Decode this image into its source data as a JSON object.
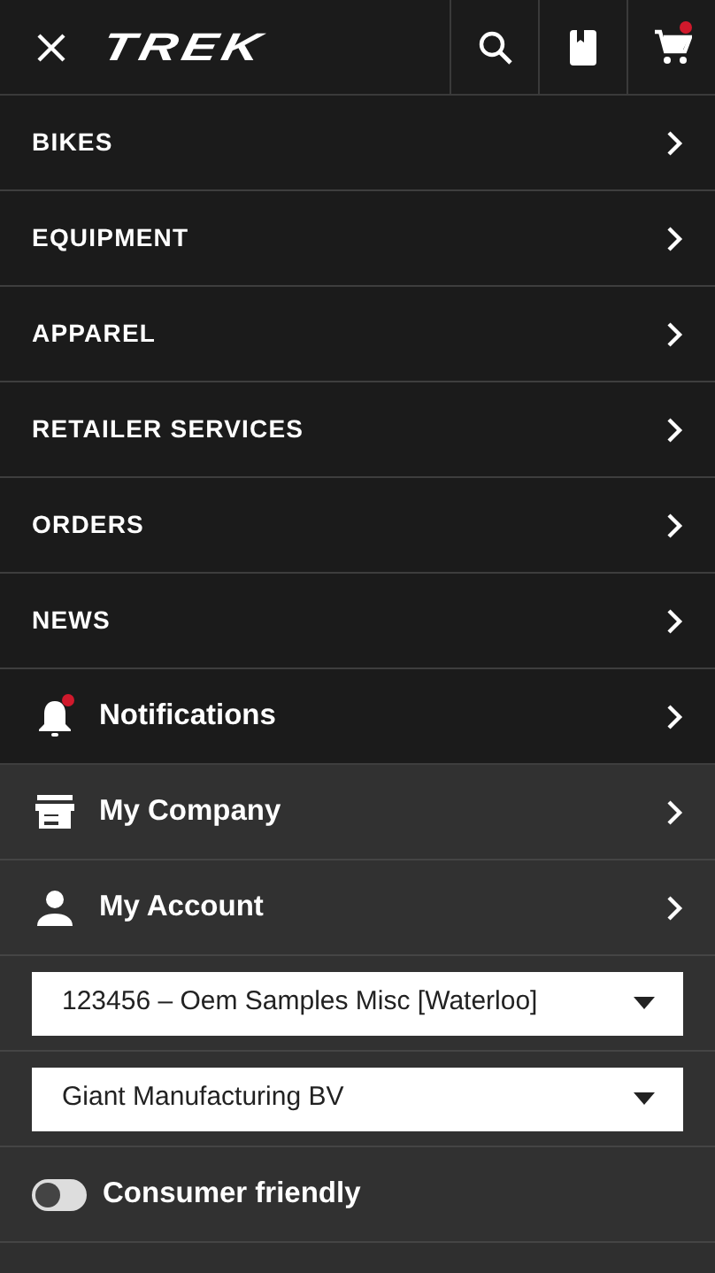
{
  "header": {
    "logo": "TREK",
    "actions": [
      {
        "kind": "search",
        "dot": false
      },
      {
        "kind": "catalog",
        "dot": false
      },
      {
        "kind": "cart",
        "dot": true
      }
    ]
  },
  "main_menu": [
    {
      "label": "BIKES",
      "kind": "section"
    },
    {
      "label": "EQUIPMENT",
      "kind": "section"
    },
    {
      "label": "APPAREL",
      "kind": "section"
    },
    {
      "label": "RETAILER SERVICES",
      "kind": "section"
    },
    {
      "label": "ORDERS",
      "kind": "section"
    },
    {
      "label": "NEWS",
      "kind": "section"
    },
    {
      "label": "Notifications",
      "kind": "icon-link",
      "dot": true
    }
  ],
  "account_menu": [
    {
      "label": "My Company",
      "kind": "icon-link",
      "dot": false
    },
    {
      "label": "My Account",
      "kind": "icon-link",
      "dot": false
    },
    {
      "kind": "select",
      "value": "123456 – Oem Samples Misc [Waterloo]"
    },
    {
      "kind": "select",
      "value": "Giant Manufacturing BV"
    },
    {
      "kind": "toggle",
      "label": "Consumer friendly",
      "on": false
    }
  ]
}
